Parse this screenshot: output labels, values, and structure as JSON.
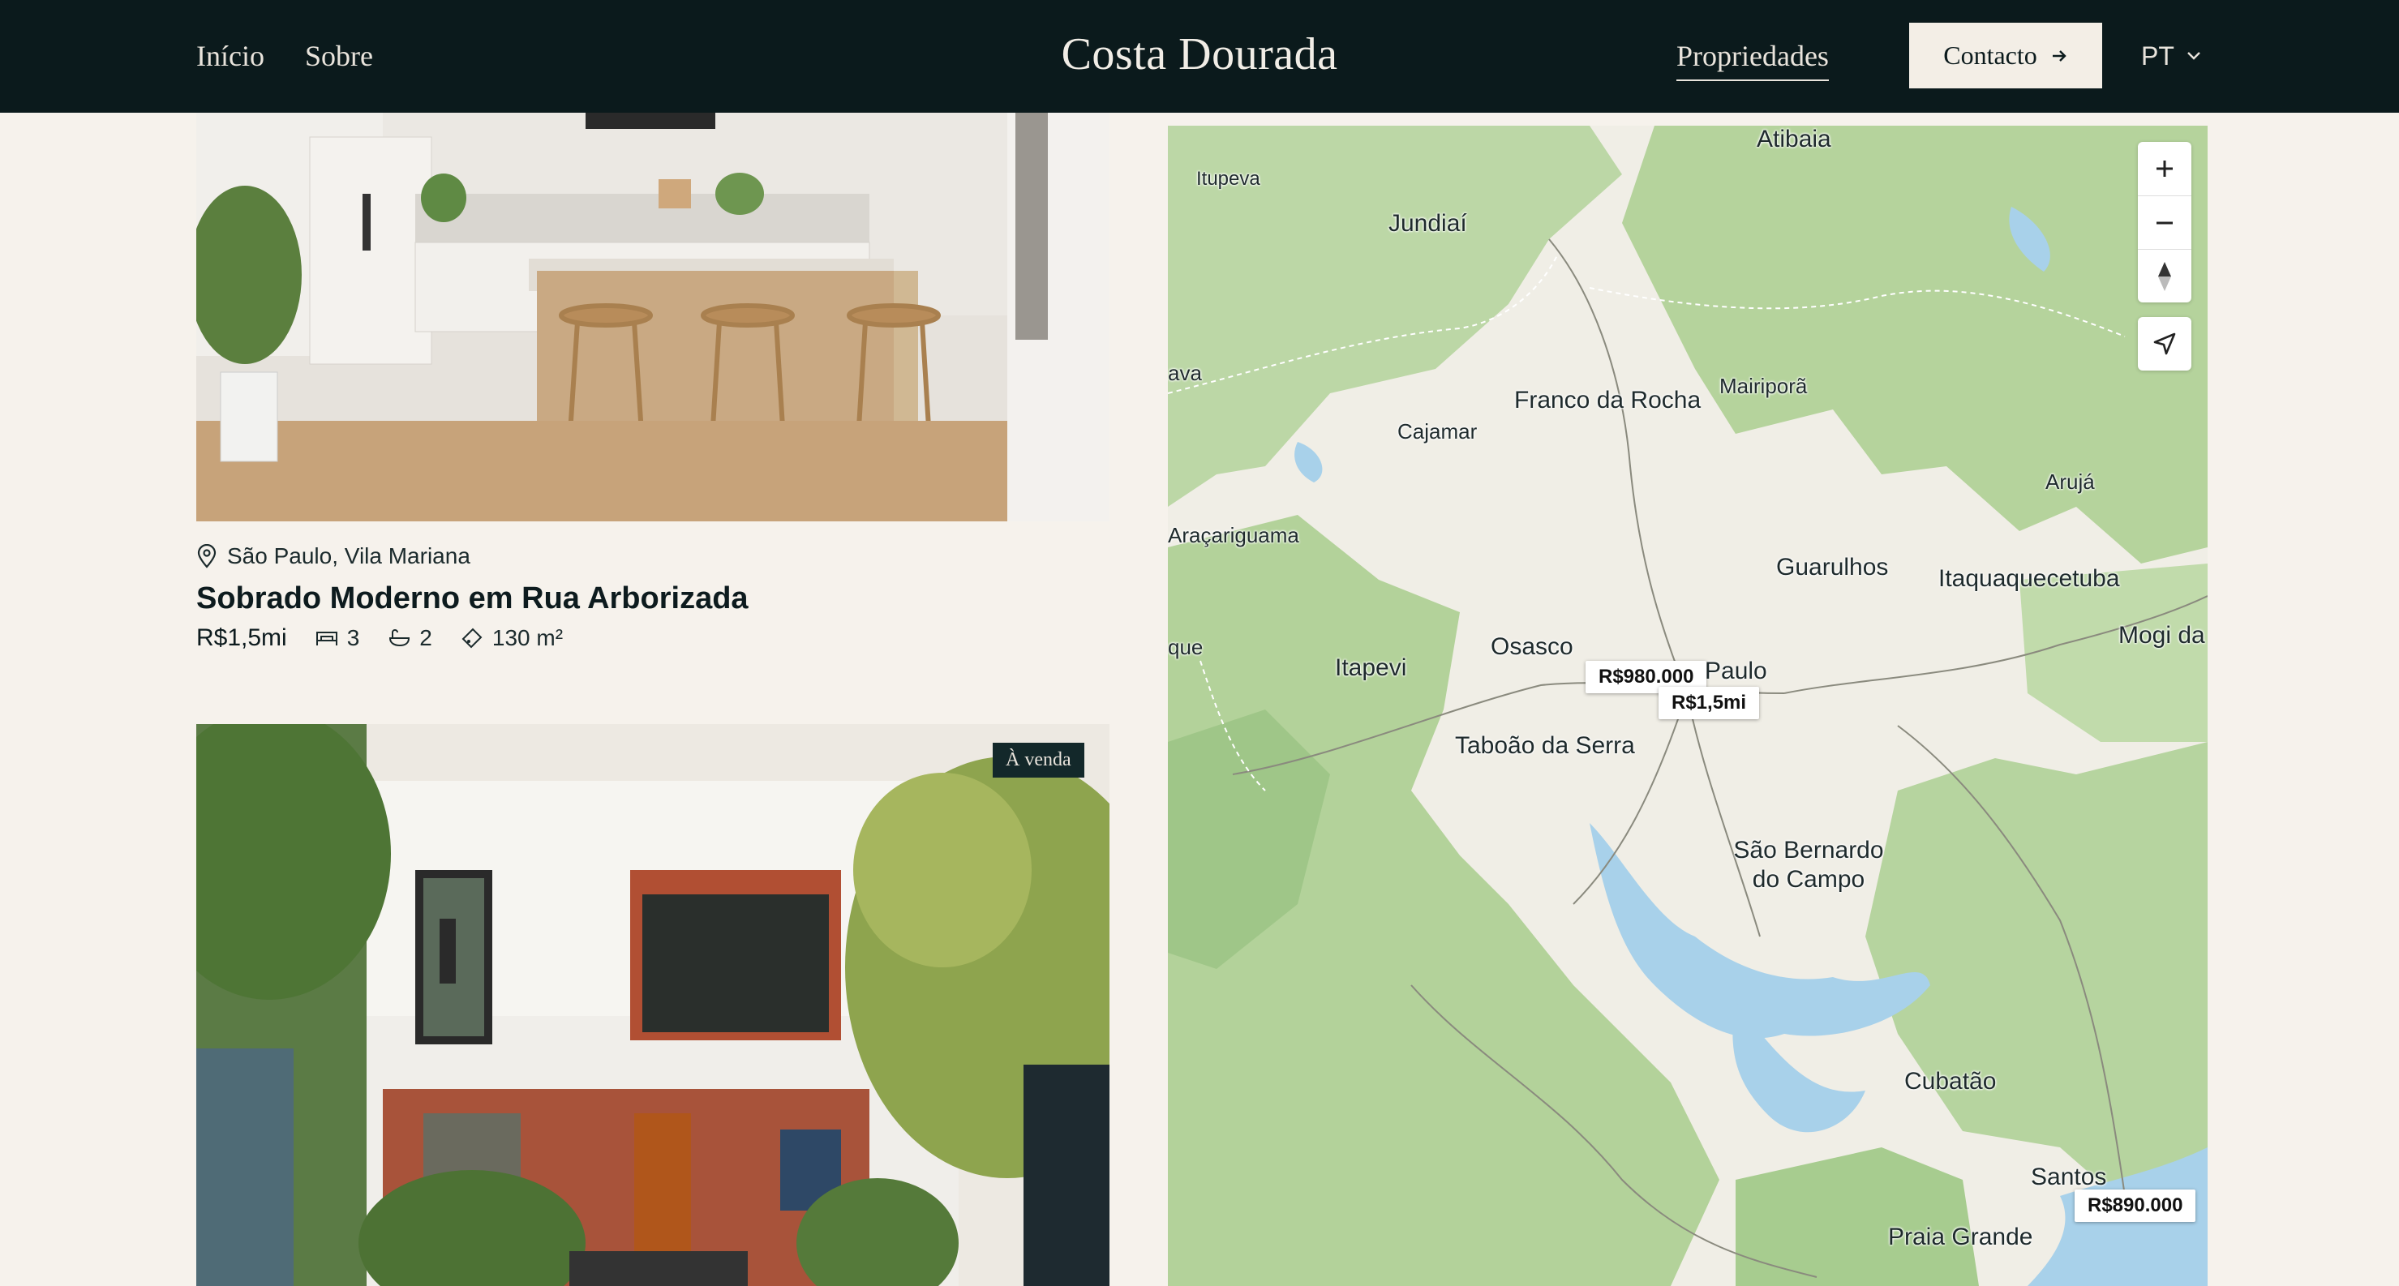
{
  "header": {
    "nav_left": [
      "Início",
      "Sobre"
    ],
    "brand": "Costa Dourada",
    "nav_active": "Propriedades",
    "contact_label": "Contacto",
    "lang": "PT"
  },
  "listings": [
    {
      "location": "São Paulo, Vila Mariana",
      "title": "Sobrado Moderno em Rua Arborizada",
      "price": "R$1,5mi",
      "bedrooms": "3",
      "bathrooms": "2",
      "area": "130 m²"
    },
    {
      "badge": "À venda"
    }
  ],
  "map": {
    "places": [
      {
        "name": "Atibaia"
      },
      {
        "name": "Itupeva"
      },
      {
        "name": "Jundiaí"
      },
      {
        "name": "Franco da Rocha"
      },
      {
        "name": "Mairiporã"
      },
      {
        "name": "Cajamar"
      },
      {
        "name": "Arujá"
      },
      {
        "name": "Araçariguama"
      },
      {
        "name": "Guarulhos"
      },
      {
        "name": "Itaquaquecetuba"
      },
      {
        "name": "Mogi da"
      },
      {
        "name": "Itapevi"
      },
      {
        "name": "Osasco"
      },
      {
        "name": "Paulo"
      },
      {
        "name": "Taboão da Serra"
      },
      {
        "name": "São Bernardo do Campo"
      },
      {
        "name": "Cubatão"
      },
      {
        "name": "Santos"
      },
      {
        "name": "Praia Grande"
      },
      {
        "name": "ava"
      },
      {
        "name": "que"
      }
    ],
    "markers": [
      "R$980.000",
      "R$1,5mi",
      "R$890.000"
    ],
    "colors": {
      "forest": "#b9d7a4",
      "urban": "#efeee8",
      "water": "#a8d1ea"
    }
  },
  "icons": {
    "location": "map-pin-icon",
    "bed": "bed-icon",
    "bath": "bath-icon",
    "area": "ruler-tag-icon",
    "arrow": "arrow-right-icon",
    "chevron": "chevron-down-icon",
    "zoom_in": "plus-icon",
    "zoom_out": "minus-icon",
    "compass": "compass-icon",
    "locate": "locate-arrow-icon"
  }
}
